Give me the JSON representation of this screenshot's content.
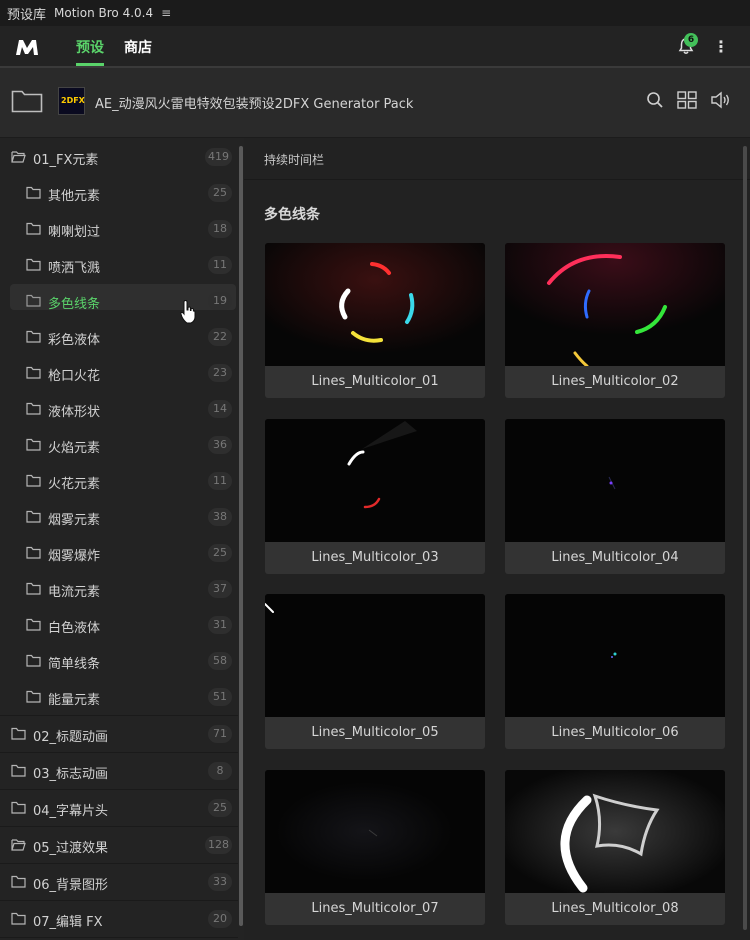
{
  "titlebar": {
    "panel_name": "预设库",
    "app_version": "Motion Bro 4.0.4",
    "menu_icon": "≡"
  },
  "nav": {
    "tab_presets": "预设",
    "tab_store": "商店",
    "notification_count": "6"
  },
  "pathbar": {
    "pack_title": "AE_动漫风火雷电特效包装预设2DFX Generator Pack",
    "pack_logo_text": "2DFX"
  },
  "colors": {
    "accent": "#5ad36a",
    "background": "#232323",
    "card": "#333333"
  },
  "sidebar": {
    "folders": [
      {
        "label": "01_FX元素",
        "count": "419"
      },
      {
        "label": "其他元素",
        "count": "25"
      },
      {
        "label": "喇喇划过",
        "count": "18"
      },
      {
        "label": "喷洒飞溅",
        "count": "11"
      },
      {
        "label": "多色线条",
        "count": "19"
      },
      {
        "label": "彩色液体",
        "count": "22"
      },
      {
        "label": "枪口火花",
        "count": "23"
      },
      {
        "label": "液体形状",
        "count": "14"
      },
      {
        "label": "火焰元素",
        "count": "36"
      },
      {
        "label": "火花元素",
        "count": "11"
      },
      {
        "label": "烟雾元素",
        "count": "38"
      },
      {
        "label": "烟雾爆炸",
        "count": "25"
      },
      {
        "label": "电流元素",
        "count": "37"
      },
      {
        "label": "白色液体",
        "count": "31"
      },
      {
        "label": "简单线条",
        "count": "58"
      },
      {
        "label": "能量元素",
        "count": "51"
      },
      {
        "label": "02_标题动画",
        "count": "71"
      },
      {
        "label": "03_标志动画",
        "count": "8"
      },
      {
        "label": "04_字幕片头",
        "count": "25"
      },
      {
        "label": "05_过渡效果",
        "count": "128"
      },
      {
        "label": "06_背景图形",
        "count": "33"
      },
      {
        "label": "07_编辑 FX",
        "count": "20"
      }
    ]
  },
  "main": {
    "section_label": "持续时间栏",
    "category_title": "多色线条",
    "presets": [
      {
        "name": "Lines_Multicolor_01"
      },
      {
        "name": "Lines_Multicolor_02"
      },
      {
        "name": "Lines_Multicolor_03"
      },
      {
        "name": "Lines_Multicolor_04"
      },
      {
        "name": "Lines_Multicolor_05"
      },
      {
        "name": "Lines_Multicolor_06"
      },
      {
        "name": "Lines_Multicolor_07"
      },
      {
        "name": "Lines_Multicolor_08"
      }
    ]
  }
}
